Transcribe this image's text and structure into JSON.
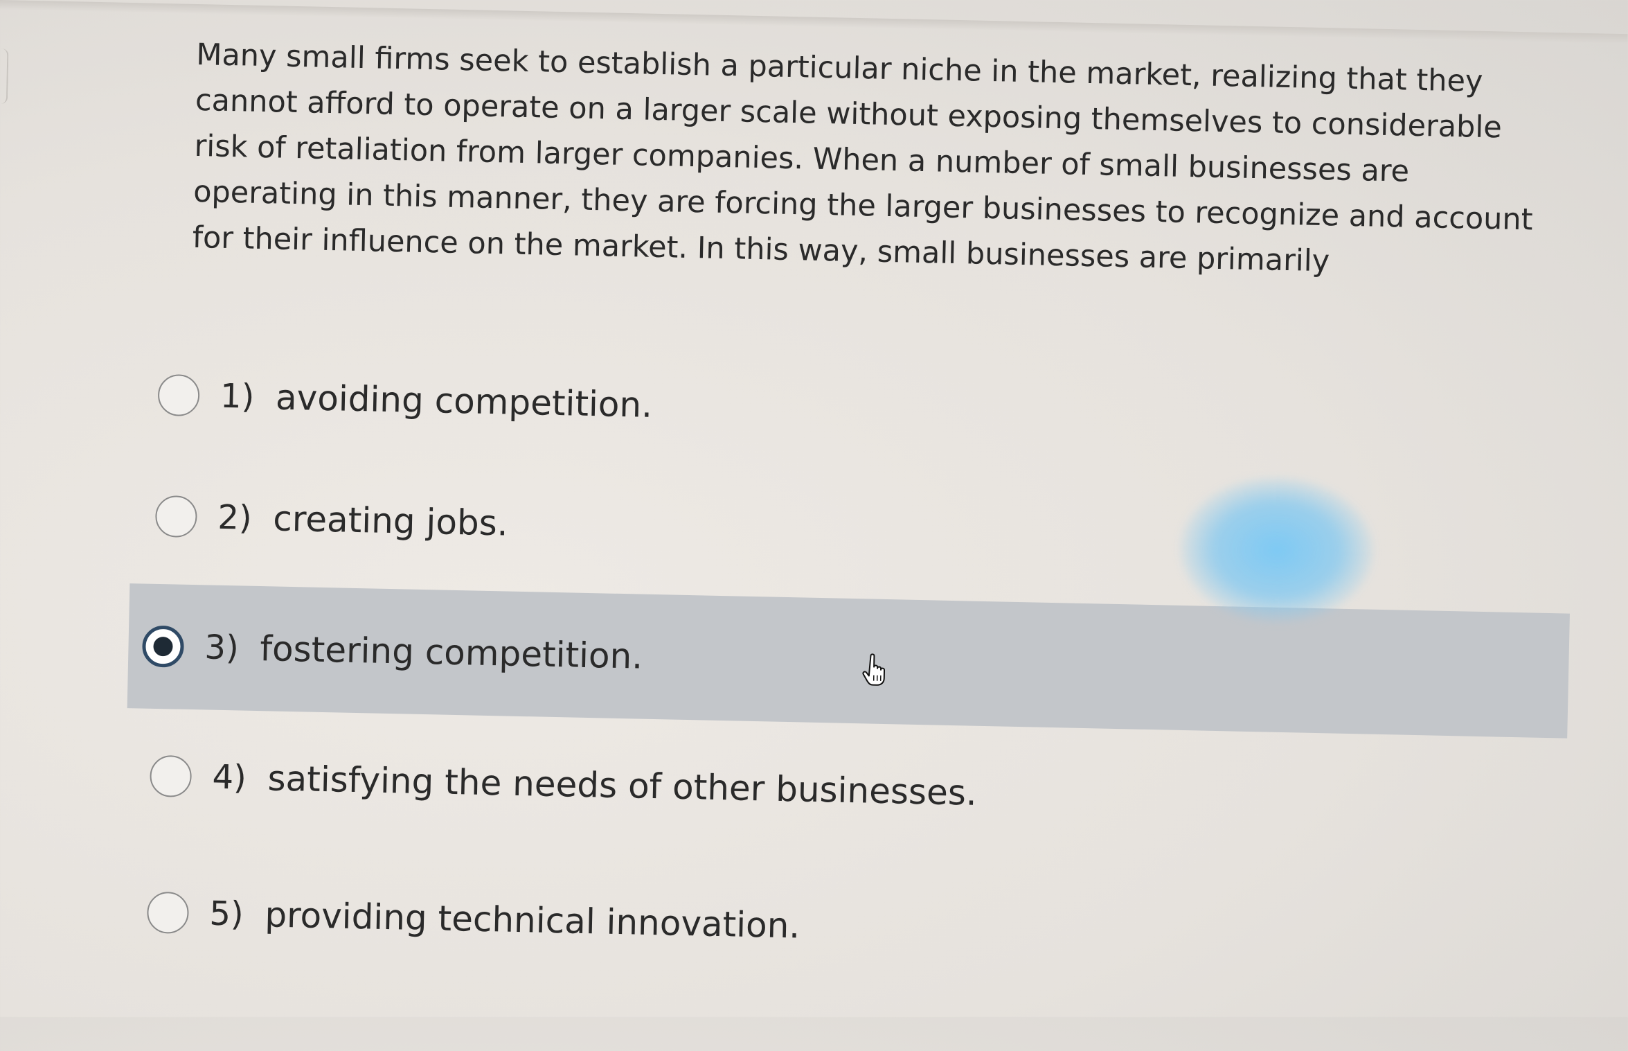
{
  "question": {
    "text": "Many small firms seek to establish a particular niche in the market, realizing that they cannot afford to operate on a larger scale without exposing themselves to considerable risk of retaliation from larger companies. When a number of small businesses are operating in this manner, they are forcing the larger businesses to recognize and account for their influence on the market. In this way, small businesses are primarily"
  },
  "options": [
    {
      "number": "1)",
      "text": "avoiding competition.",
      "selected": false
    },
    {
      "number": "2)",
      "text": "creating jobs.",
      "selected": false
    },
    {
      "number": "3)",
      "text": "fostering competition.",
      "selected": true
    },
    {
      "number": "4)",
      "text": "satisfying the needs of other businesses.",
      "selected": false
    },
    {
      "number": "5)",
      "text": "providing technical innovation.",
      "selected": false
    }
  ],
  "cursor": {
    "icon": "hand-pointer-icon"
  },
  "colors": {
    "selected_row_bg": "#c3c6ca",
    "radio_selected_border": "#2f4a66"
  }
}
